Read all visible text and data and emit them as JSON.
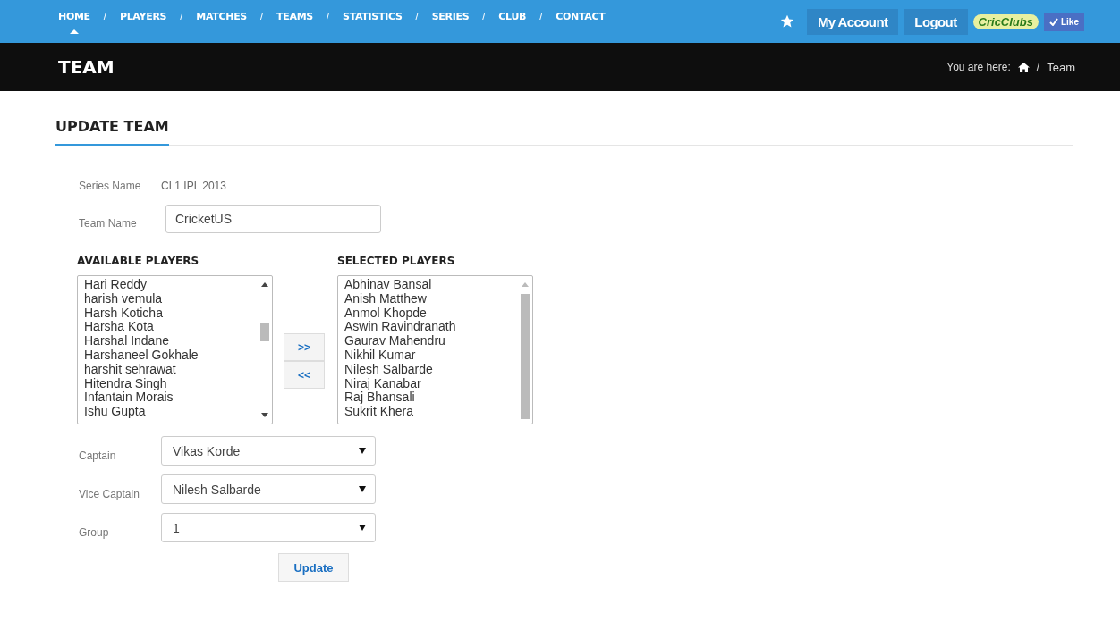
{
  "nav": {
    "items": [
      {
        "label": "HOME",
        "selected": true
      },
      {
        "label": "PLAYERS",
        "selected": false
      },
      {
        "label": "MATCHES",
        "selected": false
      },
      {
        "label": "TEAMS",
        "selected": false
      },
      {
        "label": "STATISTICS",
        "selected": false
      },
      {
        "label": "SERIES",
        "selected": false
      },
      {
        "label": "CLUB",
        "selected": false
      },
      {
        "label": "CONTACT",
        "selected": false
      }
    ],
    "separator": "/",
    "account": "My Account",
    "logout": "Logout",
    "logo": "CricClubs",
    "like": "Like"
  },
  "title_bar": {
    "title": "TEAM",
    "breadcrumb_label": "You are here:",
    "separator": "/",
    "current": "Team"
  },
  "form": {
    "heading": "UPDATE TEAM",
    "series_label": "Series Name",
    "series_value": "CL1 IPL 2013",
    "team_label": "Team Name",
    "team_value": "CricketUS",
    "available": {
      "title": "AVAILABLE PLAYERS",
      "items": [
        "Hari Reddy",
        "harish vemula",
        "Harsh Koticha",
        "Harsha Kota",
        "Harshal Indane",
        "Harshaneel Gokhale",
        "harshit sehrawat",
        "Hitendra Singh",
        "Infantain Morais",
        "Ishu Gupta"
      ]
    },
    "selected": {
      "title": "SELECTED PLAYERS",
      "items": [
        "Abhinav Bansal",
        "Anish Matthew",
        "Anmol Khopde",
        "Aswin Ravindranath",
        "Gaurav Mahendru",
        "Nikhil Kumar",
        "Nilesh Salbarde",
        "Niraj Kanabar",
        "Raj Bhansali",
        "Sukrit Khera"
      ]
    },
    "add_button": ">>",
    "remove_button": "<<",
    "selects": [
      {
        "label": "Captain",
        "value": "Vikas Korde"
      },
      {
        "label": "Vice Captain",
        "value": "Nilesh Salbarde"
      },
      {
        "label": "Group",
        "value": "1"
      }
    ],
    "submit": "Update"
  }
}
